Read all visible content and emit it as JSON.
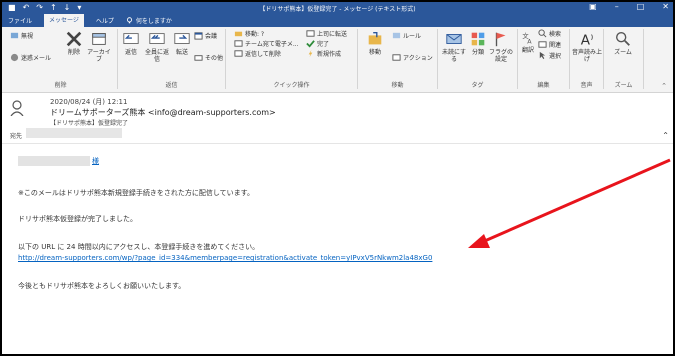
{
  "titlebar": {
    "title": "【ドリサポ熊本】仮登録完了 - メッセージ (テキスト形式)"
  },
  "menu": {
    "tabs": [
      "ファイル",
      "メッセージ",
      "ヘルプ"
    ],
    "tellme": "何をしますか"
  },
  "ribbon": {
    "delete_group": {
      "label": "削除",
      "ignore": "無視",
      "junk": "迷惑メール",
      "delete": "削除",
      "archive": "アーカイブ"
    },
    "respond_group": {
      "label": "返信",
      "reply": "返信",
      "reply_all": "全員に返信",
      "forward": "転送",
      "meeting": "会議",
      "more": "その他"
    },
    "quick_group": {
      "label": "クイック操作",
      "move_to": "移動: ?",
      "team_email": "チーム宛て電子メ...",
      "reply_delete": "返信して削除",
      "to_manager": "上司に転送",
      "done": "完了",
      "create_new": "新規作成"
    },
    "move_group": {
      "label": "移動",
      "move": "移動",
      "rules": "ルール",
      "actions": "アクション"
    },
    "tags_group": {
      "label": "タグ",
      "unread": "未読にする",
      "categorize": "分類",
      "followup": "フラグの設定"
    },
    "edit_group": {
      "label": "編集",
      "translate": "翻訳",
      "search": "検索",
      "related": "関連",
      "select": "選択"
    },
    "speech_group": {
      "label": "音声",
      "read_aloud": "音声読み上げ"
    },
    "zoom_group": {
      "label": "ズーム",
      "zoom": "ズーム"
    }
  },
  "header": {
    "date": "2020/08/24 (月) 12:11",
    "from": "ドリームサポーターズ熊本 <info@dream-supporters.com>",
    "subject": "【ドリサポ熊本】仮登録完了",
    "to_label": "宛先"
  },
  "body": {
    "salutation": "様",
    "line1": "※このメールはドリサポ熊本新規登録手続きをされた方に配信しています。",
    "line2": "ドリサポ熊本仮登録が完了しました。",
    "line3": "以下の URL に 24 時間以内にアクセスし、本登録手続きを進めてください。",
    "url": "http://dream-supporters.com/wp/?page_id=334&memberpage=registration&activate_token=yIPvxV5rNkwm2la48xG0",
    "line4": "今後ともドリサポ熊本をよろしくお願いいたします。"
  },
  "colors": {
    "titlebar": "#2b579a",
    "ribbon": "#f3f3f3",
    "link": "#0563c1",
    "arrow": "#e8141c"
  }
}
